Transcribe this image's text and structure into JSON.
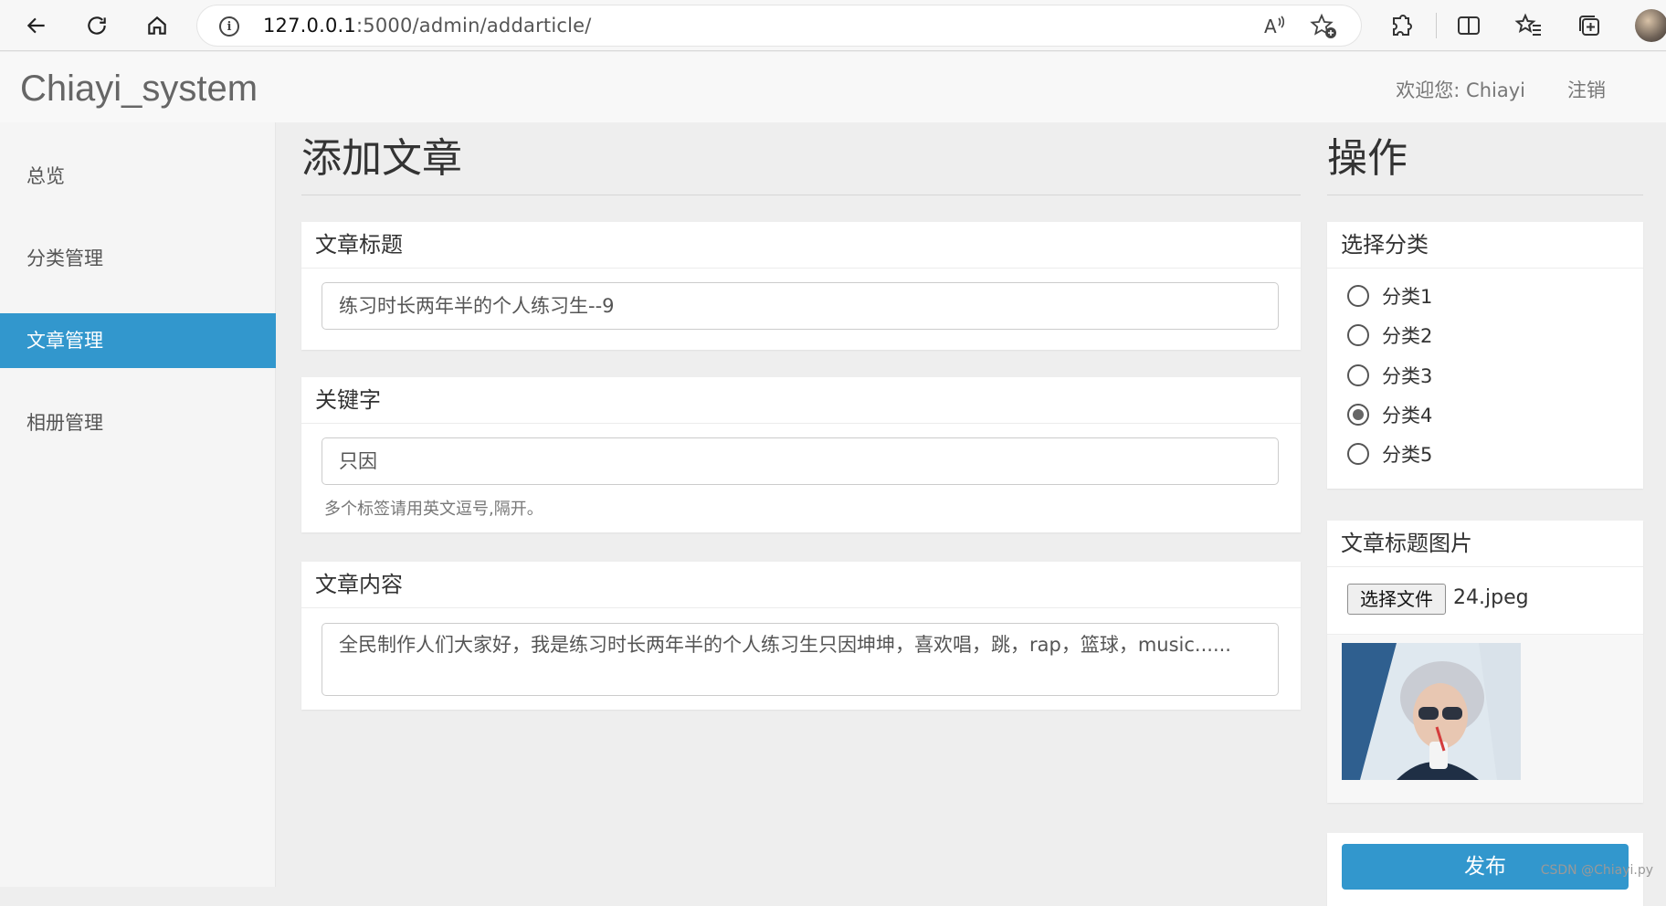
{
  "browser": {
    "url_host": "127.0.0.1",
    "url_path": ":5000/admin/addarticle/"
  },
  "header": {
    "brand": "Chiayi_system",
    "welcome": "欢迎您: Chiayi",
    "logout": "注销"
  },
  "sidebar": {
    "items": [
      {
        "label": "总览"
      },
      {
        "label": "分类管理"
      },
      {
        "label": "文章管理",
        "active": true
      },
      {
        "label": "相册管理"
      }
    ]
  },
  "main": {
    "title": "添加文章",
    "article_title": {
      "label": "文章标题",
      "value": "练习时长两年半的个人练习生--9"
    },
    "keywords": {
      "label": "关键字",
      "value": "只因",
      "help": "多个标签请用英文逗号,隔开。"
    },
    "content": {
      "label": "文章内容",
      "value": "全民制作人们大家好，我是练习时长两年半的个人练习生只因坤坤，喜欢唱，跳，rap，篮球，music......"
    }
  },
  "side_panel": {
    "title": "操作",
    "category": {
      "label": "选择分类",
      "options": [
        "分类1",
        "分类2",
        "分类3",
        "分类4",
        "分类5"
      ],
      "selected": "分类4"
    },
    "cover": {
      "label": "文章标题图片",
      "choose_button": "选择文件",
      "file_name": "24.jpeg"
    },
    "publish_button": "发布"
  },
  "watermark": "CSDN @Chiayi.py",
  "colors": {
    "accent": "#3297cd",
    "background": "#eeeeee"
  }
}
